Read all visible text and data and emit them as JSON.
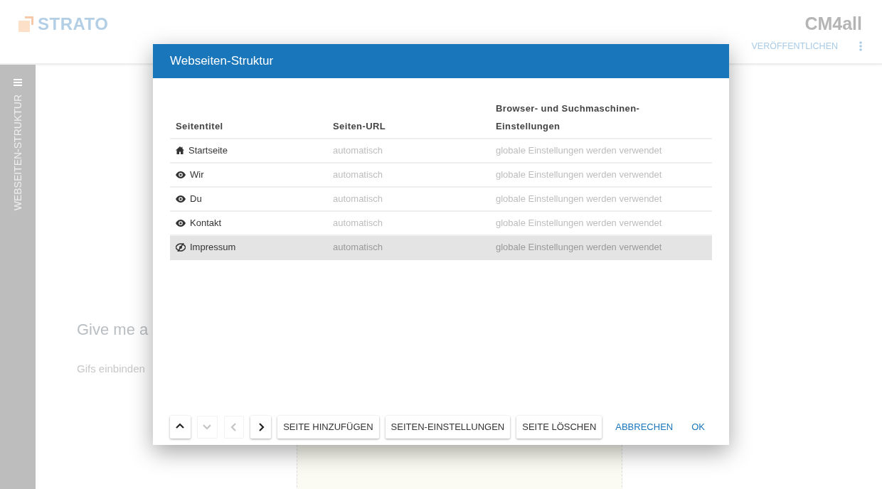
{
  "header": {
    "brand": "STRATO",
    "vendor": "CM4all",
    "actions": [
      {
        "label": "VERÖFFENTLICHEN"
      }
    ]
  },
  "sidebar": {
    "label": "WEBSEITEN-STRUKTUR"
  },
  "page": {
    "heading": "Give me a",
    "text": "Gifs einbinden"
  },
  "dialog": {
    "title": "Webseiten-Struktur",
    "columns": [
      "Seitentitel",
      "Seiten-URL",
      "Browser- und Suchmaschinen-Einstellungen"
    ],
    "rows": [
      {
        "kind": "home",
        "title": "Startseite",
        "url": "automatisch",
        "settings": "globale Einstellungen werden verwendet",
        "selected": false
      },
      {
        "kind": "visible",
        "title": "Wir",
        "url": "automatisch",
        "settings": "globale Einstellungen werden verwendet",
        "selected": false
      },
      {
        "kind": "visible",
        "title": "Du",
        "url": "automatisch",
        "settings": "globale Einstellungen werden verwendet",
        "selected": false
      },
      {
        "kind": "visible",
        "title": "Kontakt",
        "url": "automatisch",
        "settings": "globale Einstellungen werden verwendet",
        "selected": false
      },
      {
        "kind": "hidden",
        "title": "Impressum",
        "url": "automatisch",
        "settings": "globale Einstellungen werden verwendet",
        "selected": true
      }
    ],
    "move_buttons": [
      {
        "kind": "up",
        "disabled": false
      },
      {
        "kind": "down",
        "disabled": true
      },
      {
        "kind": "left",
        "disabled": true
      },
      {
        "kind": "right",
        "disabled": false
      }
    ],
    "buttons": [
      "SEITE HINZUFÜGEN",
      "SEITEN-EINSTELLUNGEN",
      "SEITE LÖSCHEN"
    ],
    "actions": [
      "ABBRECHEN",
      "OK"
    ]
  }
}
